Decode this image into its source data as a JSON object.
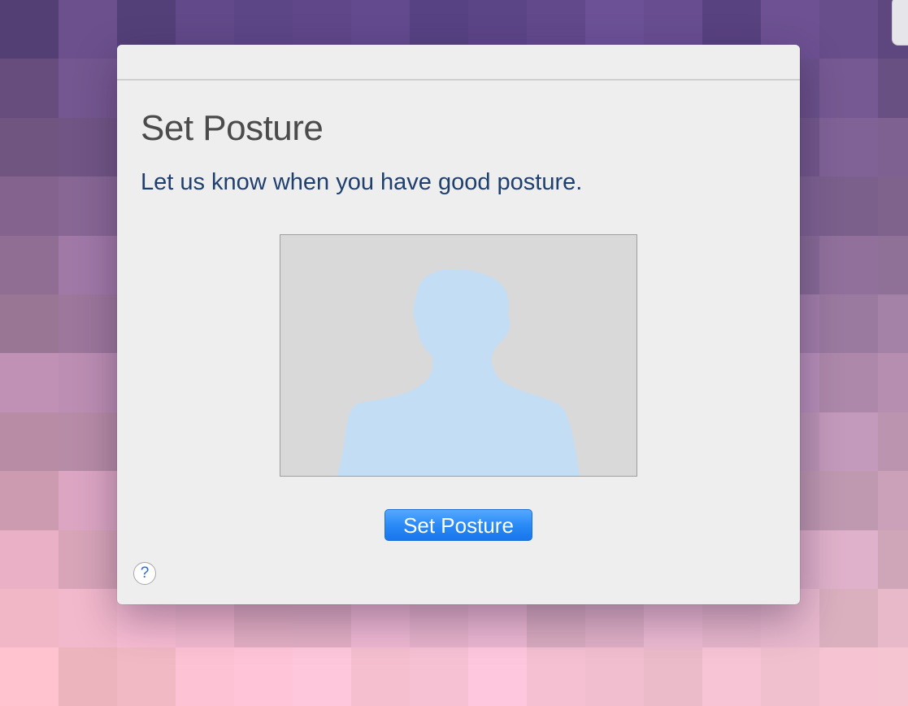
{
  "dialog": {
    "title": "Set Posture",
    "instruction": "Let us know when you have good posture.",
    "primary_button_label": "Set Posture",
    "help_label": "?"
  },
  "icons": {
    "preview_silhouette": "person-silhouette-icon",
    "help": "question-mark-icon"
  },
  "colors": {
    "accent": "#2a8af6",
    "silhouette": "#c3ddf5",
    "preview_background": "#d9d9d9",
    "title_text": "#4b4b4b",
    "instruction_text": "#1f3f6e"
  }
}
